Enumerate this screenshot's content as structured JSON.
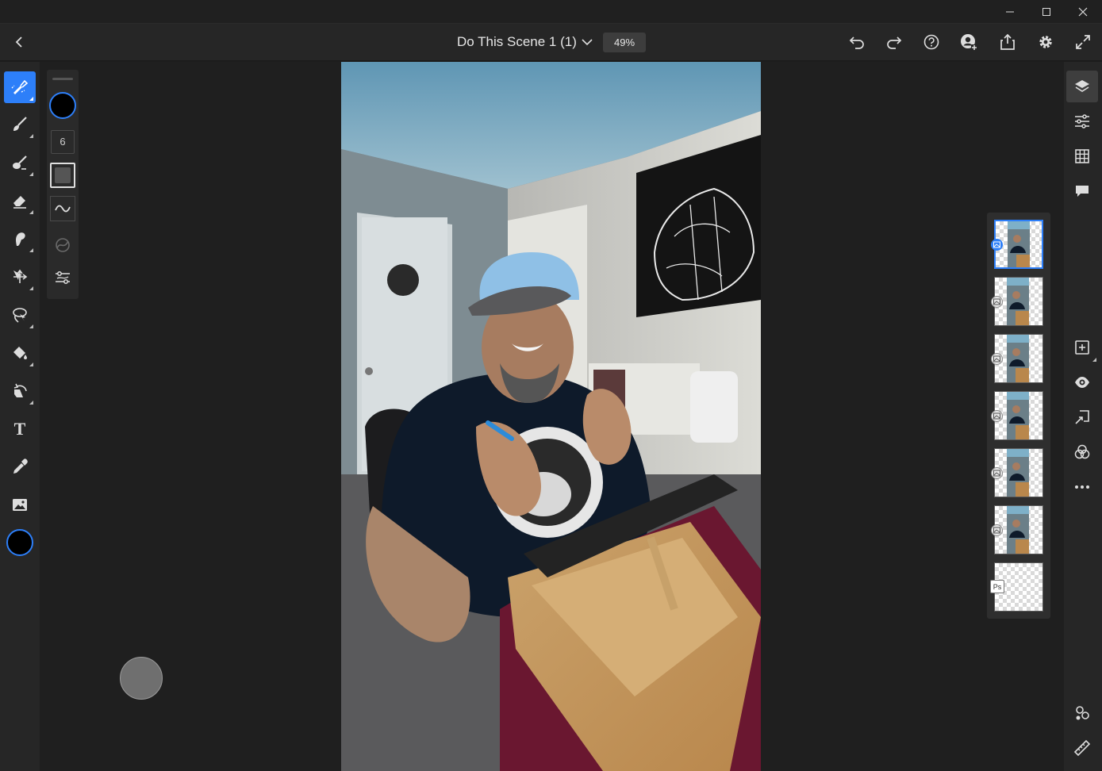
{
  "window": {
    "minimize_icon": "minimize-icon",
    "maximize_icon": "maximize-icon",
    "close_icon": "close-icon"
  },
  "appbar": {
    "back_icon": "back-arrow-icon",
    "document_title": "Do This Scene 1 (1)",
    "title_menu_icon": "chevron-down-icon",
    "zoom": "49%",
    "actions": [
      "undo-icon",
      "redo-icon",
      "help-icon",
      "invite-user-icon",
      "share-icon",
      "settings-icon",
      "fullscreen-icon"
    ]
  },
  "left_tools": [
    {
      "icon": "quick-select-brush-icon",
      "active": true
    },
    {
      "icon": "brush-icon",
      "active": false
    },
    {
      "icon": "healing-brush-icon",
      "active": false
    },
    {
      "icon": "eraser-icon",
      "active": false
    },
    {
      "icon": "smudge-icon",
      "active": false
    },
    {
      "icon": "move-icon",
      "active": false
    },
    {
      "icon": "lasso-icon",
      "active": false
    },
    {
      "icon": "paint-bucket-icon",
      "active": false
    },
    {
      "icon": "transform-icon",
      "active": false
    },
    {
      "icon": "type-icon",
      "active": false,
      "label": "T"
    },
    {
      "icon": "eyedropper-icon",
      "active": false
    },
    {
      "icon": "image-icon",
      "active": false
    }
  ],
  "tool_options": {
    "brush_size": "6",
    "color_swatch": "#000000",
    "accent": "#2d7ff9"
  },
  "right_tools": [
    "layers-icon",
    "adjustments-icon",
    "grid-icon",
    "comments-icon",
    "add-layer-icon",
    "visibility-icon",
    "import-icon",
    "blend-icon",
    "more-icon",
    "properties-icon",
    "measure-icon"
  ],
  "layers": [
    {
      "type": "image",
      "selected": true
    },
    {
      "type": "image",
      "selected": false
    },
    {
      "type": "image",
      "selected": false
    },
    {
      "type": "image",
      "selected": false
    },
    {
      "type": "image",
      "selected": false
    },
    {
      "type": "image",
      "selected": false
    },
    {
      "type": "ps",
      "selected": false,
      "badge": "Ps"
    }
  ]
}
